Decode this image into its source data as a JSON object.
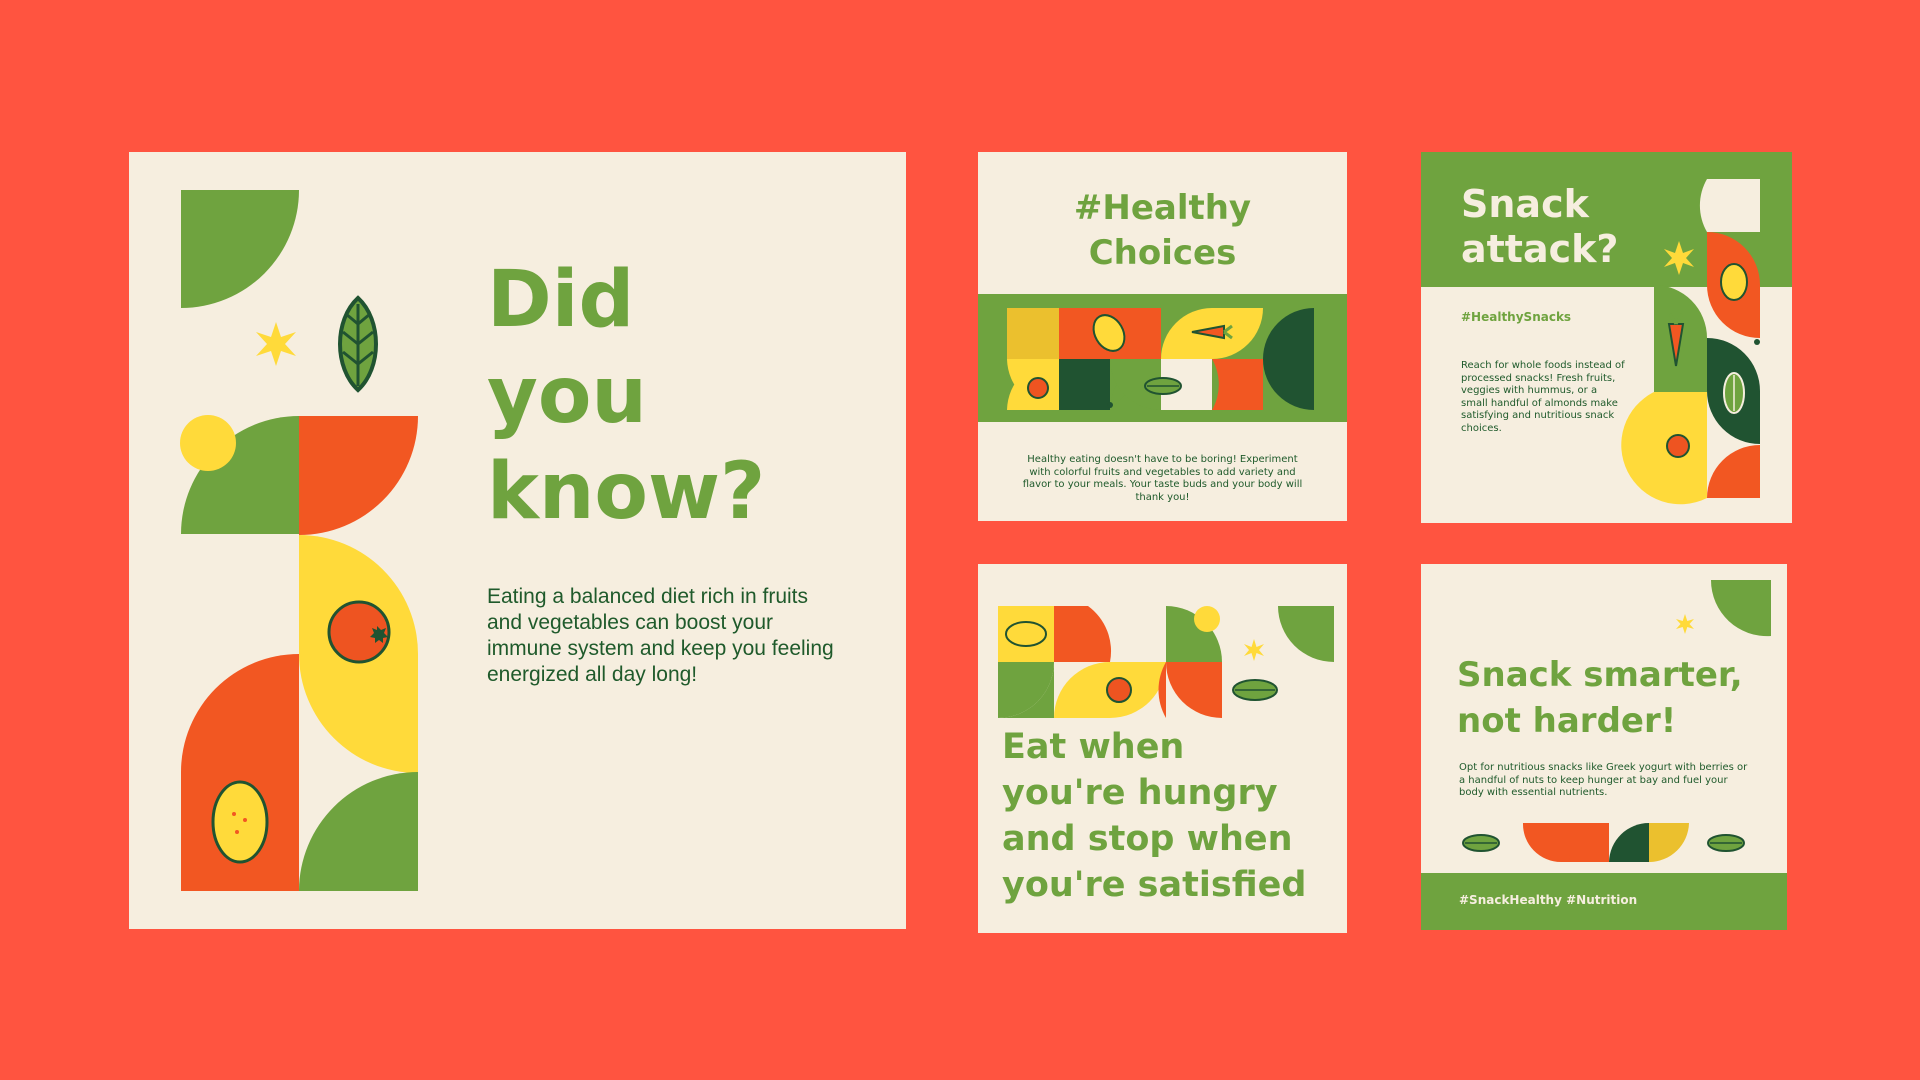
{
  "palette": {
    "background": "#FF5440",
    "cream": "#F6EEDF",
    "green": "#6FA33F",
    "dark_green": "#205331",
    "text_dark_green": "#1F5A2B",
    "orange": "#F25722",
    "red_orange": "#EE5421",
    "yellow": "#FFDA3A",
    "mustard": "#EBC02E"
  },
  "card1": {
    "title_lines": [
      "Did",
      "you",
      "know?"
    ],
    "body": "Eating a balanced diet rich in fruits and vegetables can boost your immune system and keep you feeling energized all day long!",
    "icons": [
      "leaf-icon",
      "star-icon",
      "orange-fruit-icon",
      "lemon-icon"
    ]
  },
  "card2": {
    "title_lines": [
      "#Healthy",
      "Choices"
    ],
    "body": "Healthy eating doesn't have to be boring! Experiment with colorful fruits and vegetables to add variety and flavor to your meals. Your taste buds and your body will thank you!",
    "icons": [
      "lemon-icon",
      "carrot-icon",
      "orange-fruit-icon",
      "leaf-icon"
    ]
  },
  "card3": {
    "title_lines": [
      "Snack",
      "attack?"
    ],
    "hashtag": "#HealthySnacks",
    "body": "Reach for whole foods instead of processed snacks! Fresh fruits, veggies with hummus, or a small handful of almonds make satisfying and nutritious snack choices.",
    "icons": [
      "star-icon",
      "lemon-icon",
      "carrot-icon",
      "leaf-icon",
      "orange-fruit-icon"
    ]
  },
  "card4": {
    "title_lines": [
      "Eat when",
      "you're hungry",
      "and stop when",
      "you're satisfied"
    ],
    "icons": [
      "lemon-icon",
      "orange-fruit-icon",
      "star-icon",
      "leaf-icon"
    ]
  },
  "card5": {
    "title_lines": [
      "Snack smarter,",
      "not harder!"
    ],
    "body": "Opt for nutritious snacks like Greek yogurt with berries or a handful of nuts to keep hunger at bay and fuel your body with essential nutrients.",
    "footer": "#SnackHealthy #Nutrition",
    "icons": [
      "star-icon",
      "leaf-icon"
    ]
  }
}
